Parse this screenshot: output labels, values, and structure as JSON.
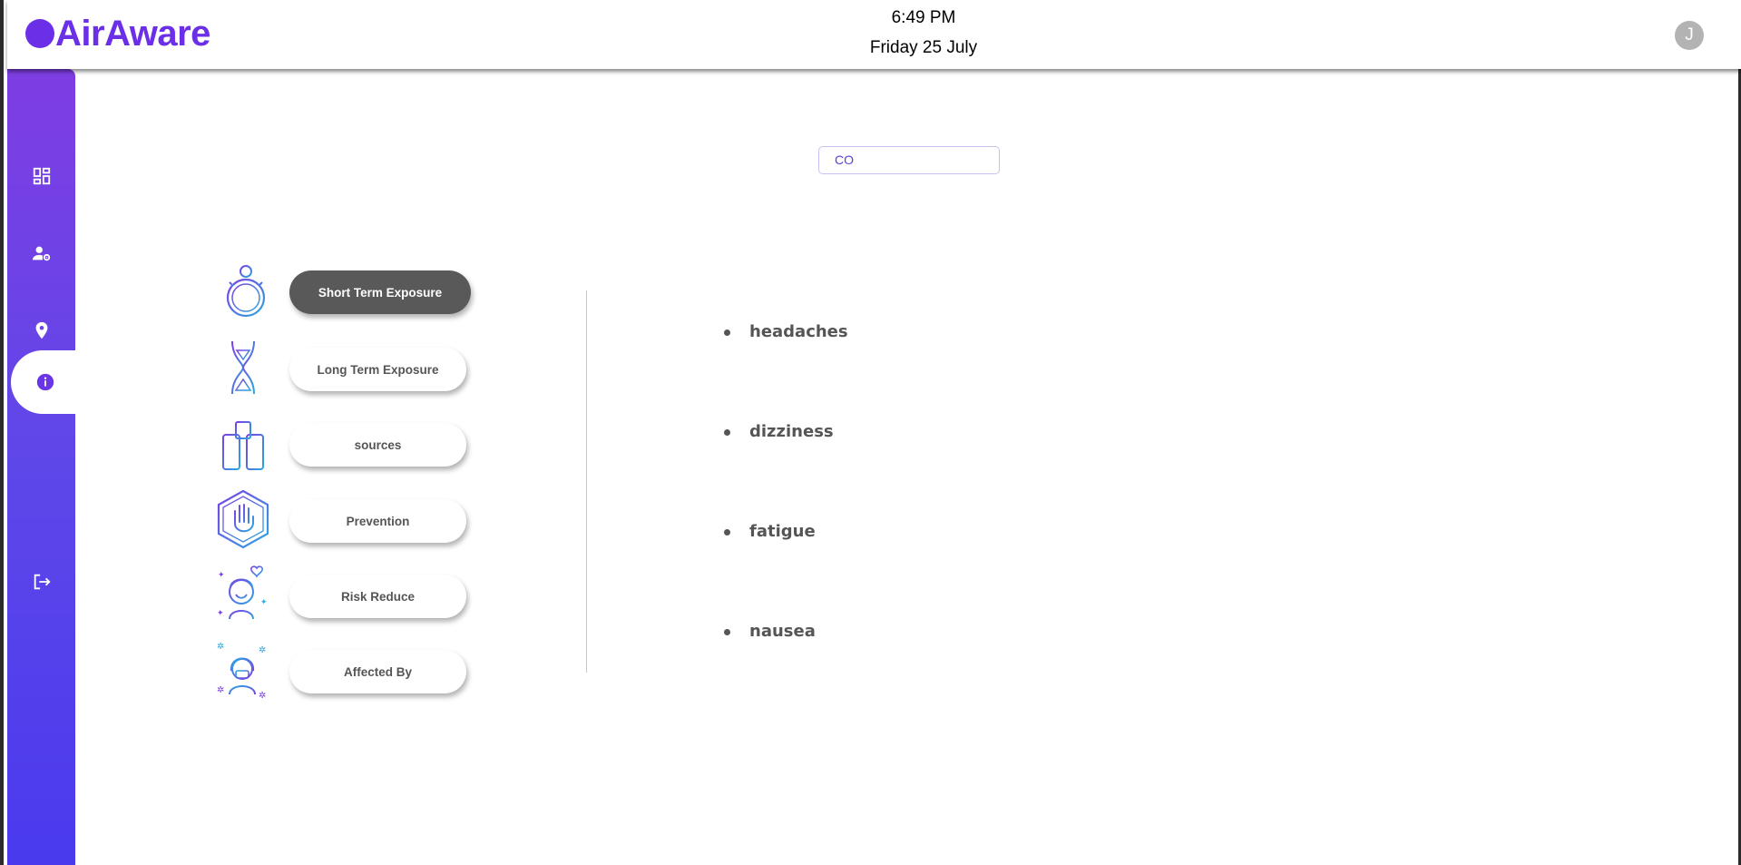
{
  "app": {
    "name": "AirAware",
    "brand_color": "#6a2fe6"
  },
  "header": {
    "time": "6:49 PM",
    "date": "Friday 25 July",
    "avatar_initial": "J"
  },
  "sidebar": {
    "items": [
      {
        "icon": "dashboard-icon",
        "active": false
      },
      {
        "icon": "user-settings-icon",
        "active": false
      },
      {
        "icon": "location-pin-icon",
        "active": false
      },
      {
        "icon": "info-icon",
        "active": true
      },
      {
        "icon": "logout-icon",
        "active": false
      }
    ],
    "gradient": [
      "#7e3de3",
      "#4a3aee"
    ]
  },
  "pollutant_select": {
    "value": "CO"
  },
  "menu": {
    "items": [
      {
        "label": "Short Term Exposure",
        "icon": "stopwatch-icon",
        "active": true
      },
      {
        "label": "Long Term Exposure",
        "icon": "hourglass-icon",
        "active": false
      },
      {
        "label": "sources",
        "icon": "gas-cylinders-icon",
        "active": false
      },
      {
        "label": "Prevention",
        "icon": "stop-hand-icon",
        "active": false
      },
      {
        "label": "Risk Reduce",
        "icon": "happy-person-icon",
        "active": false
      },
      {
        "label": "Affected By",
        "icon": "sick-person-icon",
        "active": false
      }
    ]
  },
  "effects": {
    "items": [
      "headaches",
      "dizziness",
      "fatigue",
      "nausea"
    ]
  }
}
